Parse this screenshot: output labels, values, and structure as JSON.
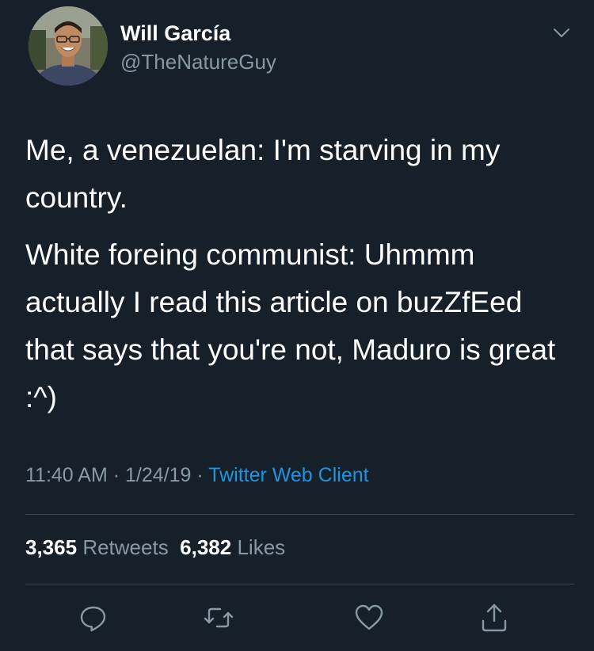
{
  "user": {
    "display_name": "Will García",
    "handle": "@TheNatureGuy"
  },
  "tweet": {
    "paragraph1": "Me, a venezuelan: I'm starving in my country.",
    "paragraph2": "White foreing communist: Uhmmm actually I read this article on buzZfEed that says that you're not, Maduro is great :^)"
  },
  "meta": {
    "time": "11:40 AM",
    "sep1": " · ",
    "date": "1/24/19",
    "sep2": " · ",
    "source": "Twitter Web Client"
  },
  "stats": {
    "retweets_count": "3,365",
    "retweets_label": "Retweets",
    "likes_count": "6,382",
    "likes_label": "Likes"
  },
  "icons": {
    "reply": "reply-icon",
    "retweet": "retweet-icon",
    "like": "heart-icon",
    "share": "share-icon",
    "menu": "chevron-down-icon"
  },
  "colors": {
    "background": "#15202b",
    "secondary_text": "#8899a6",
    "accent": "#1b95e0",
    "divider": "#38444d"
  }
}
